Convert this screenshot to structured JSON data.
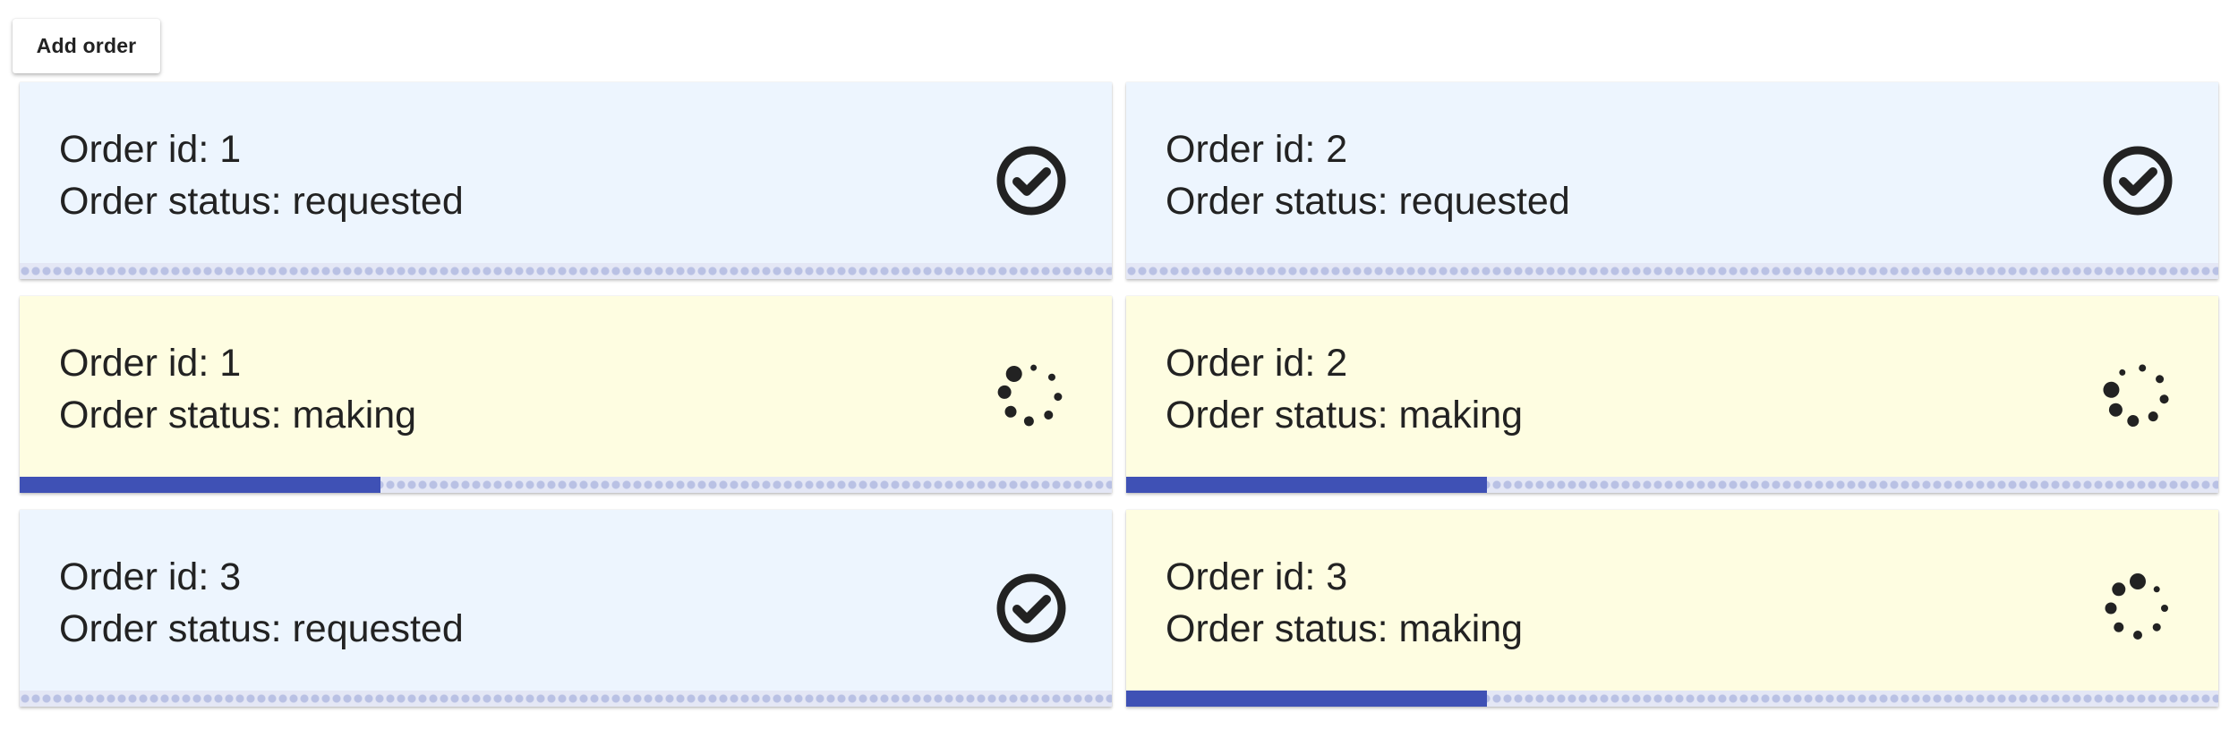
{
  "toolbar": {
    "add_order_label": "Add order"
  },
  "labels": {
    "order_id_prefix": "Order id: ",
    "order_status_prefix": "Order status: "
  },
  "colors": {
    "requested_bg": "#edf5fe",
    "making_bg": "#fefde1",
    "progress_fill": "#3f51b5",
    "progress_track": "#c5cae9"
  },
  "orders": [
    {
      "id": "1",
      "status": "requested",
      "icon": "check-circle-icon",
      "progress": 0
    },
    {
      "id": "2",
      "status": "requested",
      "icon": "check-circle-icon",
      "progress": 0
    },
    {
      "id": "1",
      "status": "making",
      "icon": "loading-spinner-icon",
      "progress": 0.33
    },
    {
      "id": "2",
      "status": "making",
      "icon": "loading-spinner-icon",
      "progress": 0.33
    },
    {
      "id": "3",
      "status": "requested",
      "icon": "check-circle-icon",
      "progress": 0
    },
    {
      "id": "3",
      "status": "making",
      "icon": "loading-spinner-icon",
      "progress": 0.33
    }
  ]
}
